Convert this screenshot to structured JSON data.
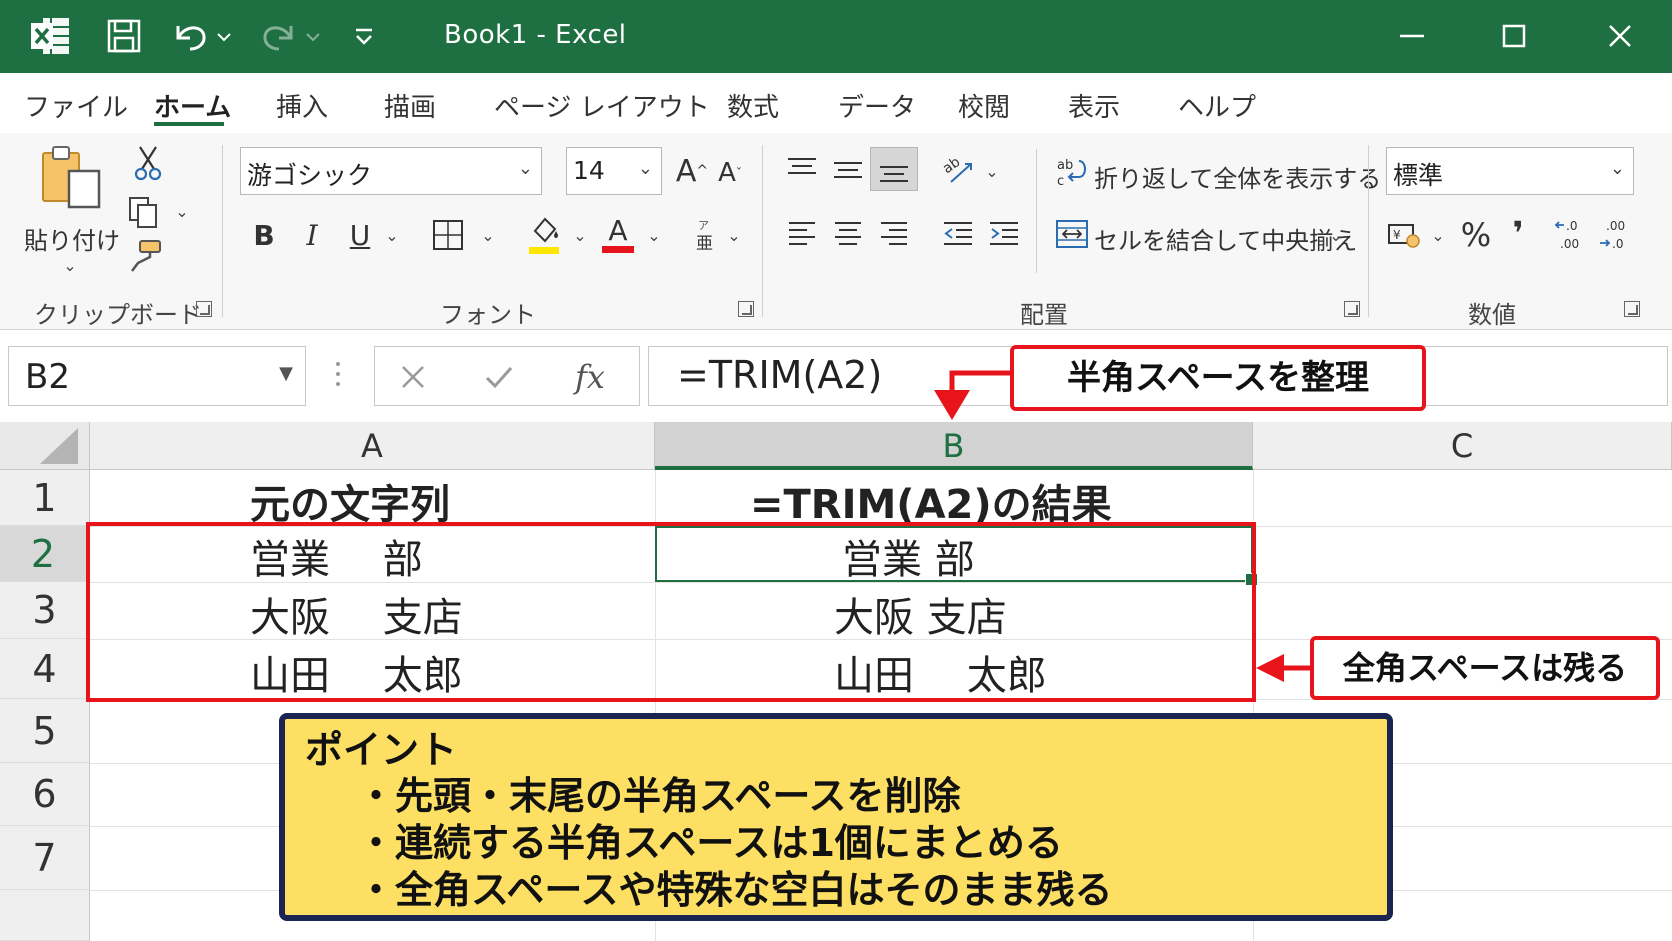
{
  "titlebar": {
    "title": "Book1  -  Excel",
    "icons": [
      "excel-logo-icon",
      "save-icon",
      "undo-icon",
      "redo-icon",
      "customize-qat-icon"
    ],
    "window_controls": [
      "minimize-icon",
      "maximize-icon",
      "close-icon"
    ]
  },
  "tabs": [
    "ファイル",
    "ホーム",
    "挿入",
    "描画",
    "ページ レイアウト",
    "数式",
    "データ",
    "校閲",
    "表示",
    "ヘルプ"
  ],
  "active_tab": "ホーム",
  "ribbon": {
    "clipboard": {
      "paste_label": "貼り付け",
      "group_label": "クリップボード"
    },
    "font": {
      "font_name": "游ゴシック",
      "font_size": "14",
      "bold": "B",
      "italic": "I",
      "underline": "U",
      "font_color_glyph": "A",
      "grow_font": "A",
      "shrink_font": "A",
      "group_label": "フォント",
      "highlight_color": "#ffe600",
      "font_color": "#e8141b"
    },
    "alignment": {
      "wrap_text": "折り返して全体を表示する",
      "merge_center": "セルを結合して中央揃え",
      "group_label": "配置"
    },
    "number": {
      "format": "標準",
      "percent": "%",
      "comma": "❜",
      "group_label": "数値"
    }
  },
  "formula_bar": {
    "name_box": "B2",
    "formula": "=TRIM(A2)",
    "fx": "fx"
  },
  "columns": [
    "A",
    "B",
    "C"
  ],
  "rows": [
    "1",
    "2",
    "3",
    "4",
    "5",
    "6",
    "7"
  ],
  "cells": {
    "A1": "元の文字列",
    "B1": "=TRIM(A2)の結果",
    "A2": "営業　 部",
    "A3": "大阪 　支店",
    "A4": "山田　 太郎",
    "B2": "営業 部",
    "B3": "大阪 支店",
    "B4": "山田　 太郎"
  },
  "annotations": {
    "top_callout": "半角スペースを整理",
    "right_callout": "全角スペースは残る",
    "accent_color": "#e8141b",
    "point_title": "ポイント",
    "point_items": [
      "・先頭・末尾の半角スペースを削除",
      "・連続する半角スペースは1個にまとめる",
      "・全角スペースや特殊な空白はそのまま残る"
    ],
    "point_bg": "#fde063",
    "point_border": "#1b2552"
  }
}
